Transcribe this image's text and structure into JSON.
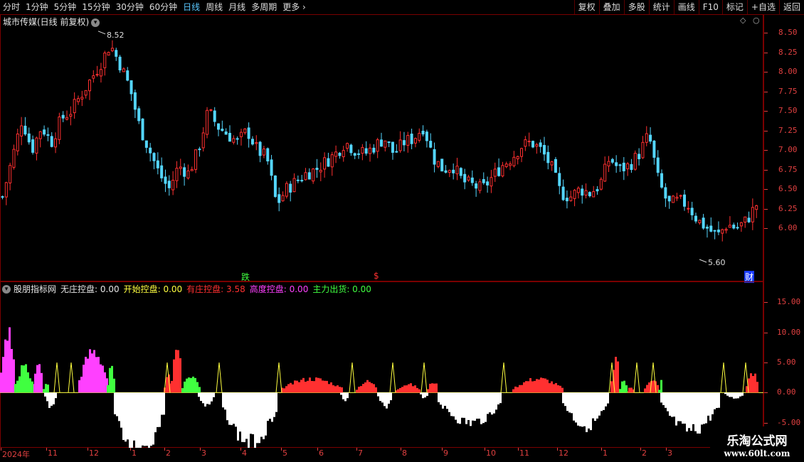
{
  "toolbar": {
    "periods": [
      "分时",
      "1分钟",
      "5分钟",
      "15分钟",
      "30分钟",
      "60分钟",
      "日线",
      "周线",
      "月线",
      "多周期",
      "更多"
    ],
    "active_period": "日线",
    "actions": [
      "复权",
      "叠加",
      "多股",
      "统计",
      "画线",
      "F10",
      "标记",
      "+自选",
      "返回"
    ]
  },
  "main_panel": {
    "title": "城市传媒(日线 前复权)",
    "price_axis": [
      "8.50",
      "8.25",
      "8.00",
      "7.75",
      "7.50",
      "7.25",
      "7.00",
      "6.75",
      "6.50",
      "6.25",
      "6.00"
    ],
    "high_label": "8.52",
    "low_label": "5.60",
    "markers": {
      "fall": "跌",
      "dollar": "$",
      "finance": "财"
    }
  },
  "indicator_panel": {
    "name": "股朋指标网",
    "items": [
      {
        "label": "无庄控盘:",
        "value": "0.00",
        "color": "#e6e6e6"
      },
      {
        "label": "开始控盘:",
        "value": "0.00",
        "color": "#ffff40"
      },
      {
        "label": "有庄控盘:",
        "value": "3.58",
        "color": "#ff3030"
      },
      {
        "label": "高度控盘:",
        "value": "0.00",
        "color": "#ff40ff"
      },
      {
        "label": "主力出货:",
        "value": "0.00",
        "color": "#40ff40"
      }
    ],
    "axis": [
      "15.00",
      "10.00",
      "5.00",
      "0.00",
      "-5.00"
    ]
  },
  "date_axis": {
    "labels": [
      "2024年",
      "11",
      "12",
      "1",
      "2",
      "3",
      "4",
      "5",
      "6",
      "7",
      "8",
      "9",
      "10",
      "11",
      "12",
      "1",
      "2",
      "3"
    ]
  },
  "watermark": {
    "title": "乐淘公式网",
    "url": "www.60lt.com"
  },
  "colors": {
    "up": "#ff3030",
    "down": "#54d6ff",
    "axis": "#e04040",
    "frame": "#7a0000"
  },
  "chart_data": {
    "type": "candlestick",
    "title": "城市传媒(日线 前复权)",
    "ylim": [
      5.5,
      8.6
    ],
    "y_ticks": [
      6.0,
      6.25,
      6.5,
      6.75,
      7.0,
      7.25,
      7.5,
      7.75,
      8.0,
      8.25,
      8.5
    ],
    "high": 8.52,
    "low": 5.6,
    "close_path": [
      6.4,
      6.9,
      7.4,
      7.0,
      7.3,
      7.1,
      7.4,
      7.5,
      7.7,
      7.9,
      8.1,
      8.35,
      8.1,
      7.8,
      7.3,
      7.0,
      6.7,
      6.5,
      6.8,
      6.7,
      7.0,
      7.5,
      7.3,
      7.2,
      7.1,
      7.25,
      7.0,
      6.9,
      6.3,
      6.5,
      6.6,
      6.7,
      6.75,
      6.85,
      6.95,
      7.1,
      7.0,
      6.95,
      7.05,
      7.15,
      6.95,
      7.1,
      7.15,
      7.3,
      6.9,
      6.75,
      6.8,
      6.6,
      6.55,
      6.5,
      6.65,
      6.8,
      6.9,
      7.05,
      7.1,
      7.0,
      6.8,
      6.45,
      6.4,
      6.5,
      6.45,
      6.55,
      6.9,
      6.75,
      6.8,
      6.95,
      7.2,
      6.6,
      6.3,
      6.35,
      6.3,
      6.1,
      6.0,
      5.9,
      6.05,
      6.0,
      6.1,
      6.3
    ]
  },
  "indicator_data": {
    "type": "bar",
    "ylim": [
      -7.5,
      17.5
    ],
    "series": [
      {
        "name": "无庄控盘",
        "color": "#ffffff",
        "segments": [
          [
            62,
            78,
            -2.5
          ],
          [
            160,
            230,
            -11.0
          ],
          [
            278,
            300,
            -2.5
          ],
          [
            312,
            388,
            -9.0
          ],
          [
            478,
            490,
            -1.5
          ],
          [
            530,
            550,
            -2.5
          ],
          [
            590,
            600,
            -1.0
          ],
          [
            615,
            705,
            -5.5
          ],
          [
            790,
            855,
            -6.0
          ],
          [
            928,
            1010,
            -7.0
          ],
          [
            1018,
            1045,
            -1.0
          ]
        ]
      },
      {
        "name": "有庄控盘",
        "color": "#ff3030",
        "segments": [
          [
            230,
            240,
            3.0
          ],
          [
            240,
            255,
            7.5
          ],
          [
            395,
            480,
            2.5
          ],
          [
            500,
            530,
            2.0
          ],
          [
            555,
            590,
            1.5
          ],
          [
            600,
            615,
            2.0
          ],
          [
            720,
            790,
            2.5
          ],
          [
            858,
            870,
            6.0
          ],
          [
            880,
            890,
            1.0
          ],
          [
            905,
            925,
            2.5
          ],
          [
            1048,
            1065,
            3.58
          ]
        ]
      },
      {
        "name": "高度控盘",
        "color": "#ff40ff",
        "segments": [
          [
            0,
            20,
            11.0
          ],
          [
            110,
            150,
            7.5
          ],
          [
            45,
            60,
            4.5
          ]
        ]
      },
      {
        "name": "主力出货",
        "color": "#40ff40",
        "segments": [
          [
            20,
            45,
            4.5
          ],
          [
            60,
            68,
            2.0
          ],
          [
            150,
            160,
            5.0
          ],
          [
            255,
            280,
            3.0
          ],
          [
            870,
            880,
            2.5
          ],
          [
            925,
            930,
            2.0
          ]
        ]
      }
    ],
    "spikes_x": [
      80,
      100,
      235,
      308,
      392,
      495,
      552,
      596,
      708,
      860,
      895,
      918,
      1017,
      1048
    ]
  }
}
